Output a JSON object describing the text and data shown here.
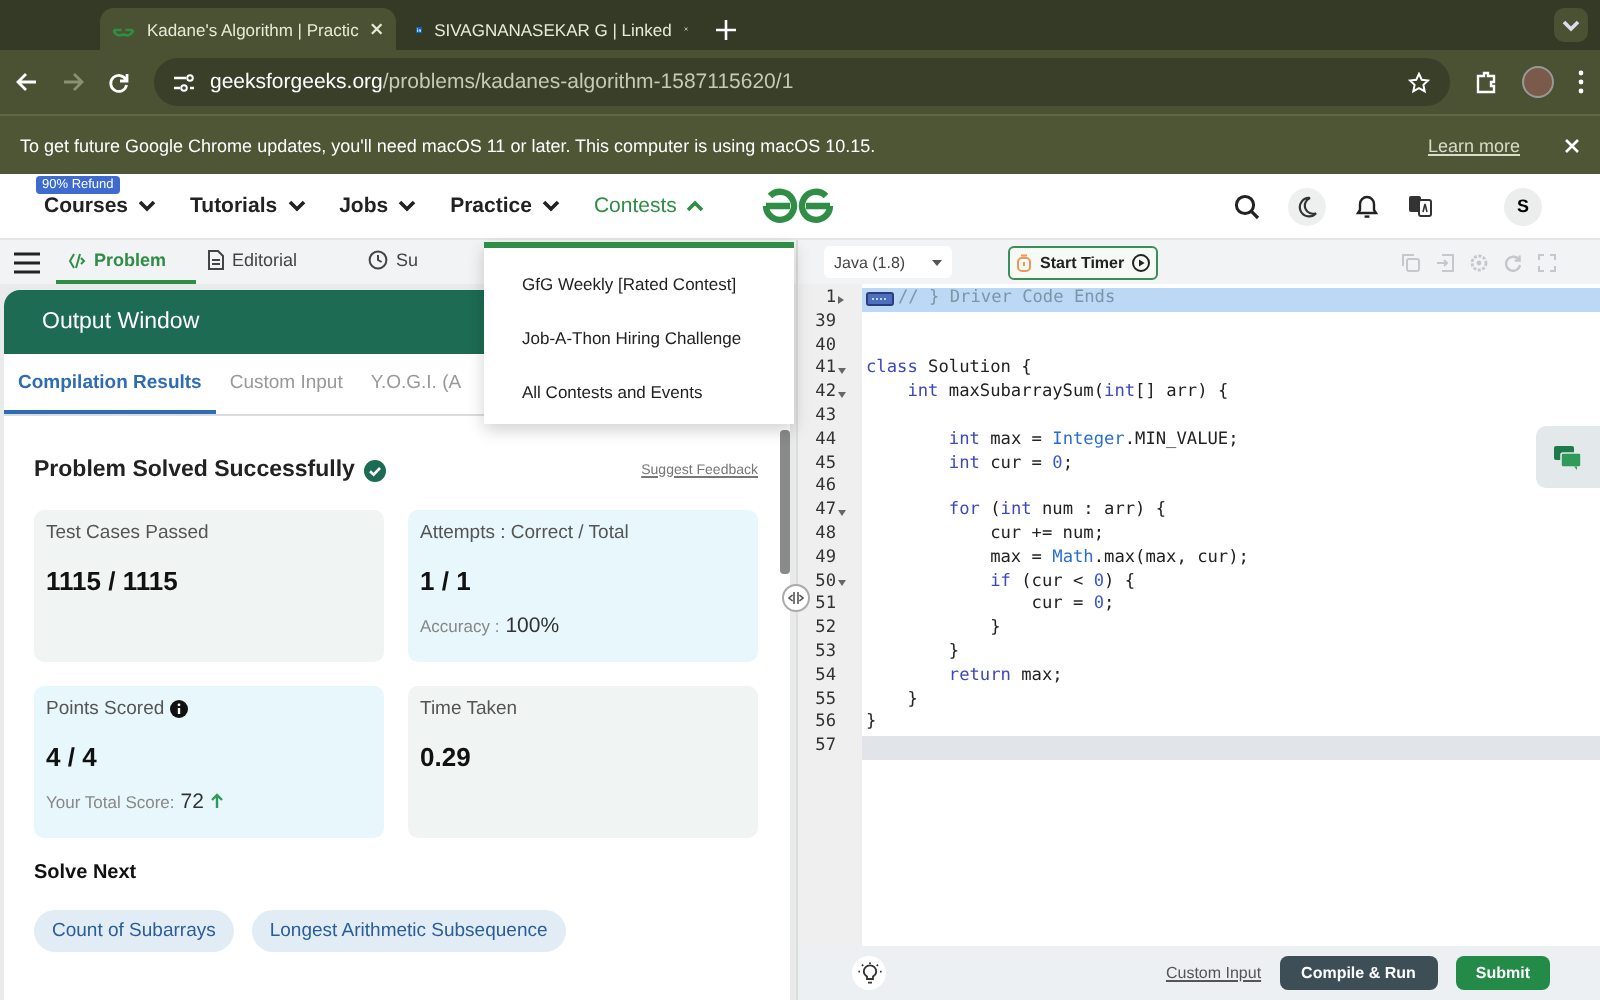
{
  "browser": {
    "tabs": [
      {
        "title": "Kadane's Algorithm | Practic",
        "selected": true
      },
      {
        "title": "SIVAGNANASEKAR G | Linked",
        "selected": false
      }
    ],
    "url_host": "geeksforgeeks.org",
    "url_path": "/problems/kadanes-algorithm-1587115620/1",
    "infobar": {
      "message": "To get future Google Chrome updates, you'll need macOS 11 or later. This computer is using macOS 10.15.",
      "link": "Learn more"
    }
  },
  "nav": {
    "badge": "90% Refund",
    "items": [
      {
        "label": "Courses",
        "expanded": false
      },
      {
        "label": "Tutorials",
        "expanded": false
      },
      {
        "label": "Jobs",
        "expanded": false
      },
      {
        "label": "Practice",
        "expanded": false
      },
      {
        "label": "Contests",
        "expanded": true
      }
    ],
    "avatar": "S"
  },
  "contests_menu": [
    "GfG Weekly [Rated Contest]",
    "Job-A-Thon Hiring Challenge",
    "All Contests and Events"
  ],
  "problem_tabs": [
    {
      "label": "Problem",
      "selected": true
    },
    {
      "label": "Editorial",
      "selected": false
    },
    {
      "label": "Su",
      "selected": false
    }
  ],
  "output": {
    "title": "Output Window",
    "tabs": [
      {
        "label": "Compilation Results",
        "selected": true
      },
      {
        "label": "Custom Input",
        "selected": false
      },
      {
        "label": "Y.O.G.I. (A",
        "selected": false
      }
    ],
    "status": "Problem Solved Successfully",
    "feedback": "Suggest Feedback",
    "cards": [
      {
        "label": "Test Cases Passed",
        "value": "1115 / 1115",
        "color": "#f0f4f3",
        "info": false
      },
      {
        "label": "Attempts : Correct / Total",
        "value": "1 / 1",
        "color": "#e7f7fb",
        "info": false,
        "note": {
          "label": "Accuracy :",
          "value": "100%",
          "rising": false
        }
      },
      {
        "label": "Points Scored",
        "value": "4 / 4",
        "color": "#e7f7fb",
        "info": true,
        "note": {
          "label": "Your Total Score:",
          "value": "72",
          "rising": true
        }
      },
      {
        "label": "Time Taken",
        "value": "0.29",
        "color": "#f0f4f3",
        "info": false
      }
    ],
    "solve_next_title": "Solve Next",
    "solve_next": [
      "Count of Subarrays",
      "Longest Arithmetic Subsequence"
    ]
  },
  "editor": {
    "language": "Java (1.8)",
    "timer": "Start Timer",
    "lines": [
      {
        "num": "1",
        "kind": "fold-marker",
        "foldable": true,
        "selected": true,
        "active": false,
        "tokens": [
          {
            "kind": "comment",
            "text": "// } Driver Code Ends"
          }
        ]
      },
      {
        "num": "39",
        "kind": "code",
        "foldable": false,
        "selected": false,
        "active": false
      },
      {
        "num": "40",
        "kind": "code",
        "foldable": false,
        "selected": false,
        "active": false
      },
      {
        "num": "41",
        "kind": "code",
        "foldable": true,
        "selected": false,
        "active": false,
        "tokens": [
          {
            "kind": "keyword",
            "text": "class"
          },
          {
            "kind": "plain",
            "text": " Solution {"
          }
        ]
      },
      {
        "num": "42",
        "kind": "code",
        "foldable": true,
        "selected": false,
        "active": false,
        "tokens": [
          {
            "kind": "keyword",
            "text": "    int"
          },
          {
            "kind": "plain",
            "text": " maxSubarraySum("
          },
          {
            "kind": "keyword",
            "text": "int"
          },
          {
            "kind": "plain",
            "text": "[] arr) {"
          }
        ]
      },
      {
        "num": "43",
        "kind": "code",
        "foldable": false,
        "selected": false,
        "active": false
      },
      {
        "num": "44",
        "kind": "code",
        "foldable": false,
        "selected": false,
        "active": false,
        "tokens": [
          {
            "kind": "keyword",
            "text": "        int"
          },
          {
            "kind": "plain",
            "text": " max = "
          },
          {
            "kind": "type",
            "text": "Integer"
          },
          {
            "kind": "plain",
            "text": ".MIN_VALUE;"
          }
        ]
      },
      {
        "num": "45",
        "kind": "code",
        "foldable": false,
        "selected": false,
        "active": false,
        "tokens": [
          {
            "kind": "keyword",
            "text": "        int"
          },
          {
            "kind": "plain",
            "text": " cur = "
          },
          {
            "kind": "number",
            "text": "0"
          },
          {
            "kind": "plain",
            "text": ";"
          }
        ]
      },
      {
        "num": "46",
        "kind": "code",
        "foldable": false,
        "selected": false,
        "active": false
      },
      {
        "num": "47",
        "kind": "code",
        "foldable": true,
        "selected": false,
        "active": false,
        "tokens": [
          {
            "kind": "keyword",
            "text": "        for"
          },
          {
            "kind": "plain",
            "text": " ("
          },
          {
            "kind": "keyword",
            "text": "int"
          },
          {
            "kind": "plain",
            "text": " num : arr) {"
          }
        ]
      },
      {
        "num": "48",
        "kind": "code",
        "foldable": false,
        "selected": false,
        "active": false,
        "tokens": [
          {
            "kind": "plain",
            "text": "            cur += num;"
          }
        ]
      },
      {
        "num": "49",
        "kind": "code",
        "foldable": false,
        "selected": false,
        "active": false,
        "tokens": [
          {
            "kind": "plain",
            "text": "            max = "
          },
          {
            "kind": "type",
            "text": "Math"
          },
          {
            "kind": "plain",
            "text": ".max(max, cur);"
          }
        ]
      },
      {
        "num": "50",
        "kind": "code",
        "foldable": true,
        "selected": false,
        "active": false,
        "tokens": [
          {
            "kind": "keyword",
            "text": "            if"
          },
          {
            "kind": "plain",
            "text": " (cur < "
          },
          {
            "kind": "number",
            "text": "0"
          },
          {
            "kind": "plain",
            "text": ") {"
          }
        ]
      },
      {
        "num": "51",
        "kind": "code",
        "foldable": false,
        "selected": false,
        "active": false,
        "tokens": [
          {
            "kind": "plain",
            "text": "                cur = "
          },
          {
            "kind": "number",
            "text": "0"
          },
          {
            "kind": "plain",
            "text": ";"
          }
        ]
      },
      {
        "num": "52",
        "kind": "code",
        "foldable": false,
        "selected": false,
        "active": false,
        "tokens": [
          {
            "kind": "plain",
            "text": "            }"
          }
        ]
      },
      {
        "num": "53",
        "kind": "code",
        "foldable": false,
        "selected": false,
        "active": false,
        "tokens": [
          {
            "kind": "plain",
            "text": "        }"
          }
        ]
      },
      {
        "num": "54",
        "kind": "code",
        "foldable": false,
        "selected": false,
        "active": false,
        "tokens": [
          {
            "kind": "keyword",
            "text": "        return"
          },
          {
            "kind": "plain",
            "text": " max;"
          }
        ]
      },
      {
        "num": "55",
        "kind": "code",
        "foldable": false,
        "selected": false,
        "active": false,
        "tokens": [
          {
            "kind": "plain",
            "text": "    }"
          }
        ]
      },
      {
        "num": "56",
        "kind": "code",
        "foldable": false,
        "selected": false,
        "active": false,
        "tokens": [
          {
            "kind": "plain",
            "text": "}"
          }
        ]
      },
      {
        "num": "57",
        "kind": "code",
        "foldable": false,
        "selected": false,
        "active": true
      }
    ],
    "custom_input": "Custom Input",
    "compile": "Compile & Run",
    "submit": "Submit"
  }
}
